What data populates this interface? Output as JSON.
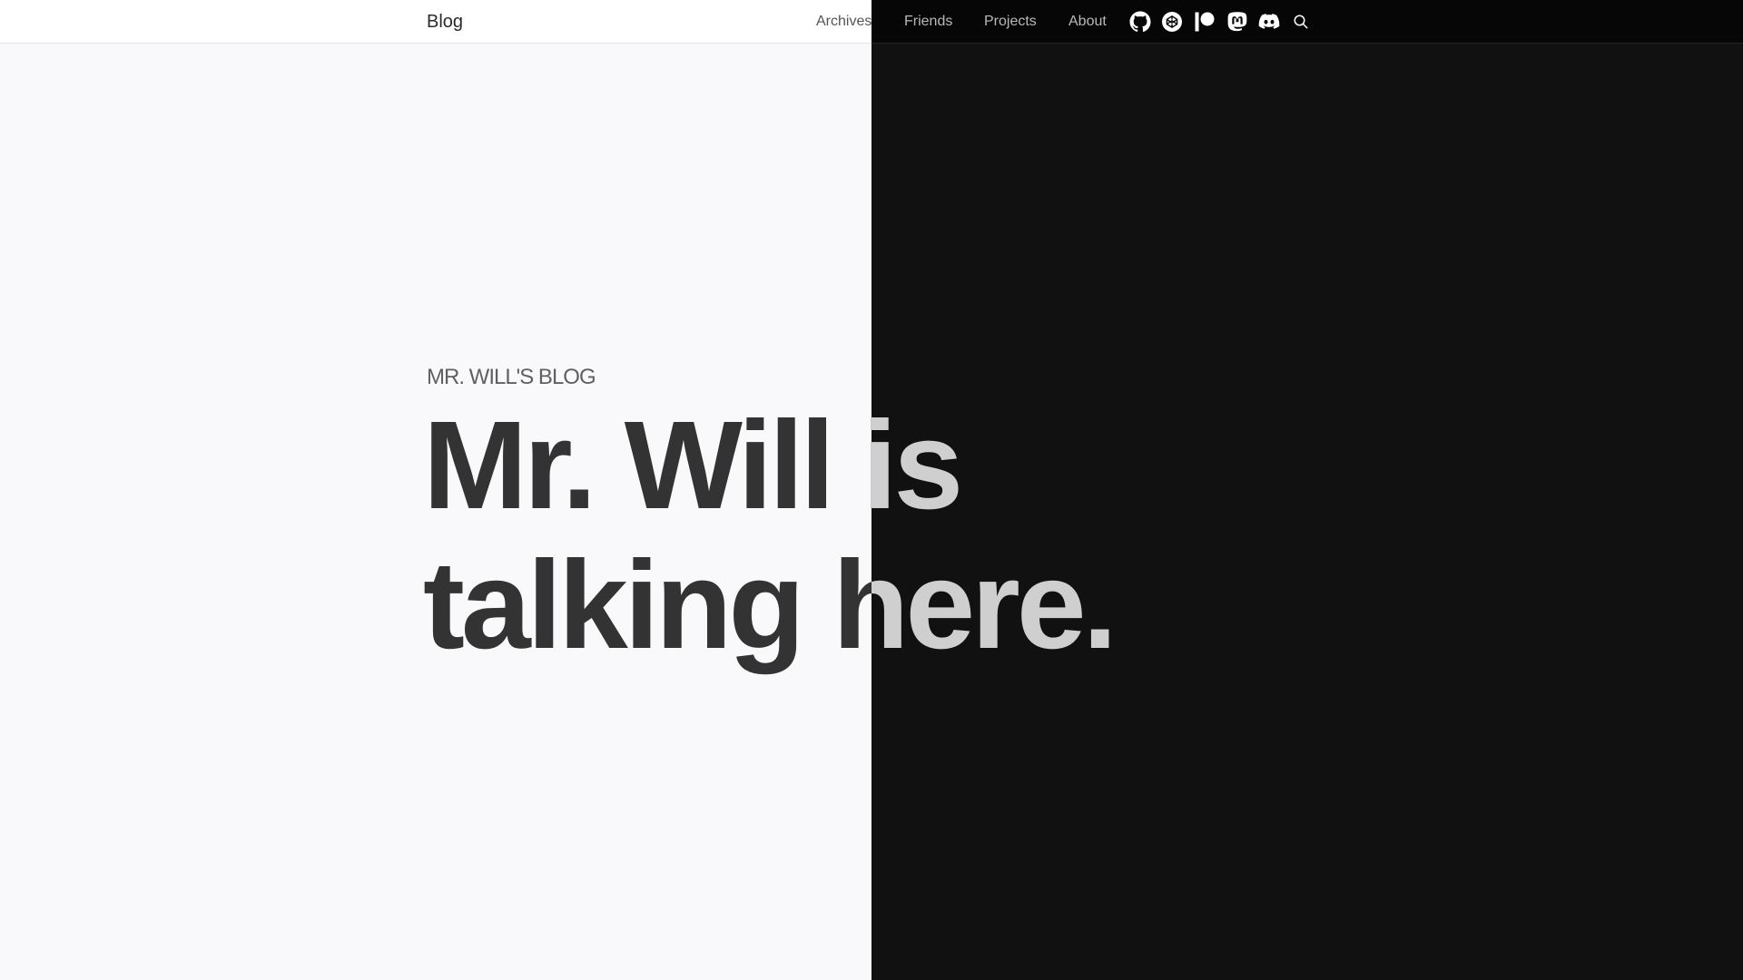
{
  "navbar": {
    "brand": "Blog",
    "links": [
      {
        "label": "Archives"
      },
      {
        "label": "Friends"
      },
      {
        "label": "Projects"
      },
      {
        "label": "About"
      }
    ],
    "icons": [
      "github-icon",
      "codepen-icon",
      "patreon-icon",
      "mastodon-icon",
      "discord-icon",
      "search-icon"
    ]
  },
  "hero": {
    "kicker": "MR. WILL'S BLOG",
    "title": "Mr. Will is talking here."
  },
  "theme": {
    "light_background": "#f9f9fb",
    "dark_background": "#111111",
    "light_text": "#333333",
    "dark_text": "#cfcfcf"
  }
}
